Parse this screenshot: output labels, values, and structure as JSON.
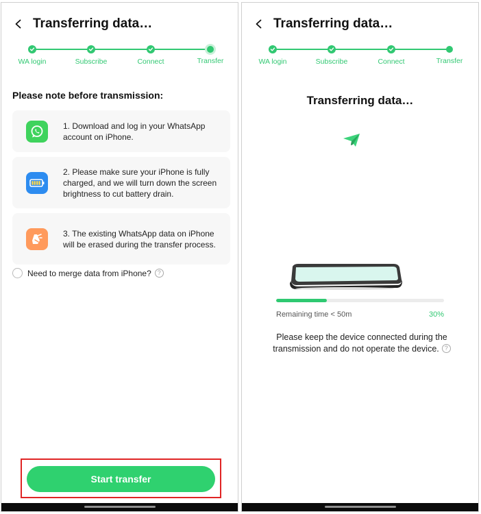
{
  "left_screen": {
    "header": {
      "title": "Transferring data…"
    },
    "steps": [
      {
        "label": "WA login"
      },
      {
        "label": "Subscribe"
      },
      {
        "label": "Connect"
      },
      {
        "label": "Transfer"
      }
    ],
    "section_title": "Please note before transmission:",
    "notes": [
      {
        "icon": "whatsapp-icon",
        "text": "1. Download and log in your WhatsApp account on iPhone."
      },
      {
        "icon": "battery-icon",
        "text": "2. Please make sure your iPhone is fully charged, and we will turn down the screen brightness to cut battery drain."
      },
      {
        "icon": "erase-icon",
        "text": "3. The existing WhatsApp data on iPhone will be erased during the transfer process."
      }
    ],
    "merge_option": {
      "label": "Need to merge data from iPhone?",
      "help_symbol": "?"
    },
    "start_button": {
      "label": "Start transfer"
    }
  },
  "right_screen": {
    "header": {
      "title": "Transferring data…"
    },
    "steps": [
      {
        "label": "WA login"
      },
      {
        "label": "Subscribe"
      },
      {
        "label": "Connect"
      },
      {
        "label": "Transfer"
      }
    ],
    "title": "Transferring data…",
    "progress": {
      "value": 0.3,
      "remaining": "Remaining time < 50m",
      "percent_label": "30%"
    },
    "notice": "Please keep the device connected during the transmission and do not operate the device.",
    "help_symbol": "?"
  },
  "colors": {
    "accent": "#31c872",
    "button": "#2fd16f",
    "highlight_border": "#e02424",
    "whatsapp": "#3fd35d",
    "battery": "#2d8cf0",
    "erase": "#ff9a5c"
  }
}
